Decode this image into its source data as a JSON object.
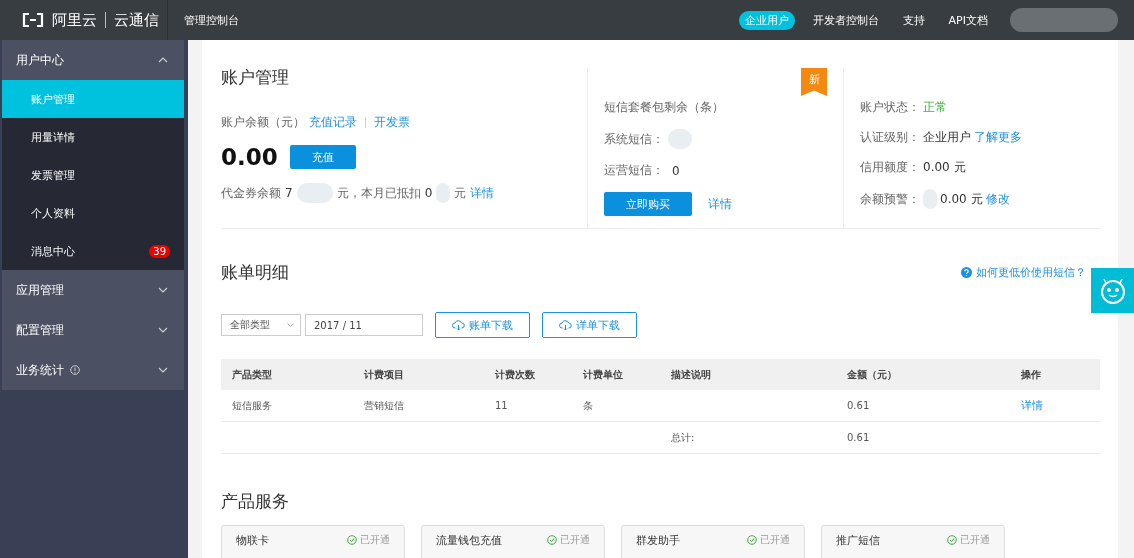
{
  "header": {
    "logo": "阿里云",
    "product": "云通信",
    "console": "管理控制台",
    "nav": [
      {
        "label": "企业用户",
        "selected": true
      },
      {
        "label": "开发者控制台",
        "selected": false
      },
      {
        "label": "支持",
        "selected": false
      },
      {
        "label": "API文档",
        "selected": false
      }
    ]
  },
  "sidebar": {
    "groups": [
      {
        "label": "用户中心",
        "expanded": true,
        "info": false,
        "children": [
          {
            "label": "账户管理",
            "selected": true
          },
          {
            "label": "用量详情",
            "selected": false
          },
          {
            "label": "发票管理",
            "selected": false
          },
          {
            "label": "个人资料",
            "selected": false
          },
          {
            "label": "消息中心",
            "selected": false,
            "badge": "39"
          }
        ]
      },
      {
        "label": "应用管理",
        "expanded": false,
        "info": false
      },
      {
        "label": "配置管理",
        "expanded": false,
        "info": false
      },
      {
        "label": "业务统计",
        "expanded": false,
        "info": true
      }
    ]
  },
  "account": {
    "title": "账户管理",
    "balance_label": "账户余额（元）",
    "links": [
      "充值记录",
      "开发票"
    ],
    "amount": "0.00",
    "recharge_button": "充值",
    "voucher": {
      "label": "代金券余额",
      "value": "7",
      "middle": "元，本月已抵扣",
      "deducted": "0",
      "unit": "元",
      "link": "详情"
    }
  },
  "sms_package": {
    "badge": "新",
    "title": "短信套餐包剩余（条）",
    "rows": [
      {
        "label": "系统短信：",
        "masked": true
      },
      {
        "label": "运营短信：",
        "value": "0",
        "masked": false
      }
    ],
    "buy_button": "立即购买",
    "detail_link": "详情"
  },
  "status": {
    "rows": [
      {
        "label": "账户状态：",
        "value": "正常",
        "kind": "status",
        "masked": false
      },
      {
        "label": "认证级别：",
        "value": "企业用户",
        "link": "了解更多",
        "kind": "text",
        "masked": false
      },
      {
        "label": "信用额度：",
        "value": "0.00 元",
        "kind": "text",
        "masked": false
      },
      {
        "label": "余额预警：",
        "value": "0.00 元",
        "link": "修改",
        "kind": "text",
        "masked": true
      }
    ]
  },
  "bill": {
    "title": "账单明细",
    "help_link": "如何更低价使用短信？",
    "type_select": "全部类型",
    "month_field": "2017 / 11",
    "buttons": [
      "账单下载",
      "详单下载"
    ],
    "columns": [
      "产品类型",
      "计费项目",
      "计费次数",
      "计费单位",
      "描述说明",
      "金额（元）",
      "操作"
    ],
    "rows": [
      {
        "cells": [
          "短信服务",
          "营销短信",
          "11",
          "条",
          "",
          "0.61"
        ],
        "action": "详情"
      }
    ],
    "total": {
      "label": "总计:",
      "value": "0.61"
    }
  },
  "products": {
    "title": "产品服务",
    "cards": [
      {
        "name": "物联卡",
        "status": "已开通"
      },
      {
        "name": "流量钱包充值",
        "status": "已开通"
      },
      {
        "name": "群发助手",
        "status": "已开通"
      },
      {
        "name": "推广短信",
        "status": "已开通"
      }
    ]
  }
}
